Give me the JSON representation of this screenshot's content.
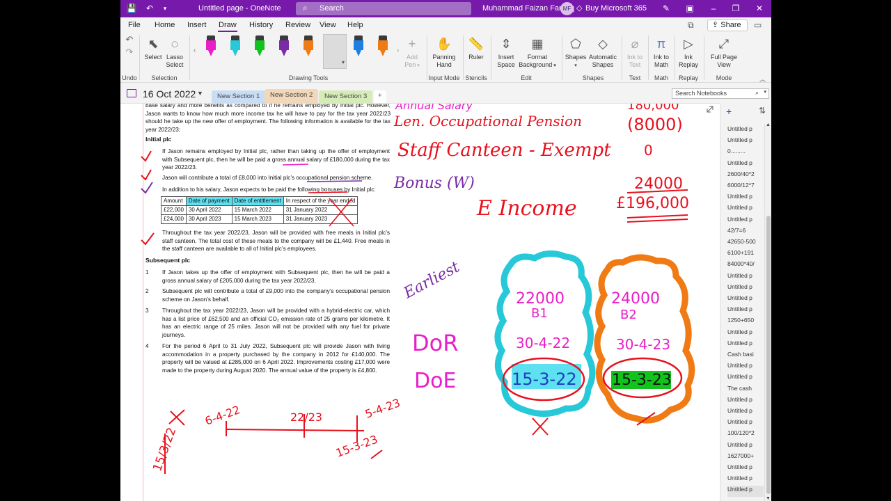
{
  "titlebar": {
    "title": "Untitled page  -  OneNote",
    "search_label": "Search",
    "user_name": "Muhammad Faizan Farooq",
    "user_initials": "MF",
    "buy_label": "Buy Microsoft 365"
  },
  "menu": {
    "tabs": [
      "File",
      "Home",
      "Insert",
      "Draw",
      "History",
      "Review",
      "View",
      "Help"
    ],
    "active": "Draw",
    "share_label": "Share"
  },
  "ribbon": {
    "undo_label": "Undo",
    "select_label": "Select",
    "lasso_label": "Lasso",
    "lasso_label2": "Select",
    "selection_group": "Selection",
    "drawing_tools_group": "Drawing Tools",
    "add_pen_label": "Add",
    "add_pen_label2": "Pen",
    "panning_label": "Panning",
    "panning_label2": "Hand",
    "input_mode_group": "Input Mode",
    "ruler_label": "Ruler",
    "stencils_group": "Stencils",
    "insert_space_label": "Insert",
    "insert_space_label2": "Space",
    "format_bg_label": "Format",
    "format_bg_label2": "Background",
    "edit_group": "Edit",
    "shapes_label": "Shapes",
    "auto_shapes_label": "Automatic",
    "auto_shapes_label2": "Shapes",
    "shapes_group": "Shapes",
    "ink_text_label": "Ink to",
    "ink_text_label2": "Text",
    "text_group": "Text",
    "ink_math_label": "Ink to",
    "ink_math_label2": "Math",
    "math_group": "Math",
    "ink_replay_label": "Ink",
    "ink_replay_label2": "Replay",
    "replay_group": "Replay",
    "full_page_label": "Full Page",
    "full_page_label2": "View",
    "mode_group": "Mode",
    "pens": [
      {
        "color": "#e91ec8"
      },
      {
        "color": "#27c9d8"
      },
      {
        "color": "#11c41b"
      },
      {
        "color": "#7a2ca6"
      },
      {
        "color": "#f07a13"
      },
      {
        "color": "#e8101d"
      },
      {
        "color": "#1e7fe0"
      },
      {
        "color": "#f07a13"
      }
    ]
  },
  "sections": {
    "date": "16 Oct 2022",
    "tabs": [
      {
        "label": "New Section 1",
        "color": "#c9ddf4"
      },
      {
        "label": "New Section 2",
        "color": "#f2d7b8"
      },
      {
        "label": "New Section 3",
        "color": "#d5ecb8"
      }
    ],
    "search_notebooks": "Search Notebooks"
  },
  "doc": {
    "intro": "base salary and more benefits as compared to if he remains employed by Initial plc. However, Jason wants to know how much more income tax he will have to pay for the tax year 2022/23 should he take up the new offer of employment. The following information is available for the tax year 2022/23:",
    "initial_heading": "Initial plc",
    "i1": "If Jason remains employed by Initial plc, rather than taking up the offer of employment with Subsequent plc, then he will be paid a gross annual salary of £180,000 during the tax year 2022/23.",
    "i2": "Jason will contribute a total of £8,000 into Initial plc’s occupational pension scheme.",
    "i3": "In addition to his salary, Jason expects to be paid the following bonuses by Initial plc:",
    "table_headers": [
      "Amount",
      "Date of payment",
      "Date of entitlement",
      "In respect of the year ended"
    ],
    "table_rows": [
      [
        "£22,000",
        "30 April 2022",
        "15 March 2022",
        "31 January 2022"
      ],
      [
        "£24,000",
        "30 April 2023",
        "15 March 2023",
        "31 January 2023"
      ]
    ],
    "i4": "Throughout the tax year 2022/23, Jason will be provided with free meals in Initial plc’s staff canteen. The total cost of these meals to the company will be £1,440. Free meals in the staff canteen are available to all of Initial plc’s employees.",
    "subsequent_heading": "Subsequent plc",
    "s1_num": "1",
    "s1": "If Jason takes up the offer of employment with Subsequent plc, then he will be paid a gross annual salary of £205,000 during the tax year 2022/23.",
    "s2_num": "2",
    "s2": "Subsequent plc will contribute a total of £9,000 into the company’s occupational pension scheme on Jason’s behalf.",
    "s3_num": "3",
    "s3": "Throughout the tax year 2022/23, Jason will be provided with a hybrid-electric car, which has a list price of £62,500 and an official CO₂ emission rate of 25 grams per kilometre.  It has an electric range of 25 miles. Jason will not be provided with any fuel for private journeys.",
    "s4_num": "4",
    "s4": "For the period 6 April to 31 July 2022, Subsequent plc will provide Jason with living accommodation in a property purchased by the company in 2012 for £140,000. The property will be valued at £285,000 on 6 April 2022. Improvements costing £17,000 were made to the property during August 2020. The annual value of the property is £4,800."
  },
  "ink_text": {
    "pension": "Len. Occupational Pension",
    "canteen": "Staff Canteen - Exempt",
    "bonus": "Bonus (W)",
    "eincome": "E Income",
    "top_right": "180,000",
    "pension_amt": "(8000)",
    "canteen_amt": "0",
    "bonus_amt": "24000",
    "total": "£196,000",
    "earliest": "Earliest",
    "dor": "DoR",
    "doe": "DoE",
    "b1_amt": "22000",
    "b1": "B1",
    "b2_amt": "24000",
    "b2": "B2",
    "b1_dor": "30-4-22",
    "b2_dor": "30-4-23",
    "b1_doe": "15-3-22",
    "b2_doe": "15-3-23",
    "tl_1": "6-4-22",
    "tl_2": "22/23",
    "tl_3": "5-4-23",
    "tl_4": "15-3-23",
    "tl_5": "15/3/22"
  },
  "pagelist": {
    "pages": [
      "Untitled p",
      "Untitled p",
      "0.........",
      "Untitled p",
      "2600/40*2",
      "6000/12*7",
      "Untitled p",
      "Untitled p",
      "Untitled p",
      "42/7=6",
      "42650-500",
      "6100+191",
      "84000*40/",
      "Untitled p",
      "Untitled p",
      "Untitled p",
      "Untitled p",
      "1250+650",
      "Untitled p",
      "Untitled p",
      "Cash basi",
      "Untitled p",
      "Untitled p",
      "The cash",
      "Untitled p",
      "Untitled p",
      "Untitled p",
      "100/120*2",
      "Untitled p",
      "1627000+",
      "Untitled p",
      "Untitled p",
      "Untitled p"
    ]
  }
}
